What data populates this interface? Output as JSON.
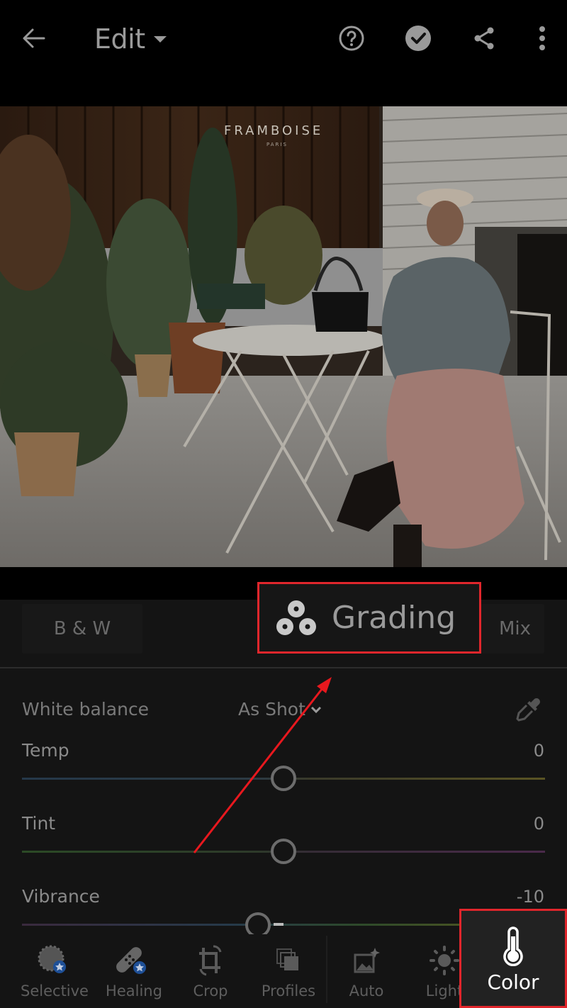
{
  "header": {
    "title": "Edit",
    "icons": [
      "back-arrow-icon",
      "help-icon",
      "done-check-icon",
      "share-icon",
      "more-vertical-icon"
    ]
  },
  "photo": {
    "sign_text": "FRAMBOISE",
    "sign_subtext": "PARIS"
  },
  "color_tabs": {
    "items": [
      {
        "label": "B & W"
      },
      {
        "label": "Grading",
        "highlighted": true
      },
      {
        "label": "Mix"
      }
    ]
  },
  "white_balance": {
    "label": "White balance",
    "value": "As Shot"
  },
  "sliders": [
    {
      "label": "Temp",
      "value": "0",
      "position": 0.5
    },
    {
      "label": "Tint",
      "value": "0",
      "position": 0.5
    },
    {
      "label": "Vibrance",
      "value": "-10",
      "position": 0.45
    }
  ],
  "bottom_nav": {
    "items": [
      {
        "label": "Selective",
        "icon": "selective-icon",
        "premium": true
      },
      {
        "label": "Healing",
        "icon": "healing-bandage-icon",
        "premium": true
      },
      {
        "label": "Crop",
        "icon": "crop-icon"
      },
      {
        "label": "Profiles",
        "icon": "profiles-icon"
      },
      {
        "label": "Auto",
        "icon": "auto-icon"
      },
      {
        "label": "Light",
        "icon": "light-sun-icon"
      },
      {
        "label": "Color",
        "icon": "thermometer-icon",
        "active": true
      }
    ]
  },
  "colors": {
    "highlight_red": "#e0262c",
    "panel_bg": "#141414"
  }
}
